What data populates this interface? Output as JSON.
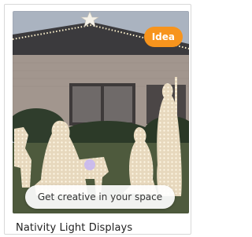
{
  "card": {
    "badge_label": "Idea",
    "cta_label": "Get creative in your space",
    "title": "Nativity Light Displays",
    "image_icon": "nativity-light-display-photo",
    "colors": {
      "badge": "#f7941d",
      "title_text": "#1f1f1f",
      "card_border": "#d8d8d8"
    }
  }
}
